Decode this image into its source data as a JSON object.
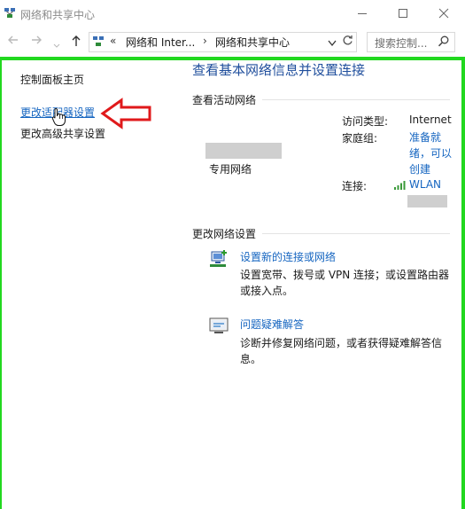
{
  "window": {
    "title": "网络和共享中心"
  },
  "address": {
    "chevrons": "«",
    "segment1": "网络和 Inter...",
    "separator": "›",
    "segment2": "网络和共享中心",
    "search_placeholder": "搜索控制..."
  },
  "sidebar": {
    "items": [
      {
        "label": "控制面板主页"
      },
      {
        "label": "更改适配器设置"
      },
      {
        "label": "更改高级共享设置"
      }
    ]
  },
  "main": {
    "title": "查看基本网络信息并设置连接",
    "active_networks_heading": "查看活动网络",
    "network_type": "专用网络",
    "access_type_label": "访问类型:",
    "access_type_value": "Internet",
    "homegroup_label": "家庭组:",
    "homegroup_value": "准备就绪，可以创建",
    "connection_label": "连接:",
    "connection_value": "WLAN",
    "change_settings_heading": "更改网络设置",
    "tasks": [
      {
        "link": "设置新的连接或网络",
        "desc": "设置宽带、拨号或 VPN 连接；或设置路由器或接入点。"
      },
      {
        "link": "问题疑难解答",
        "desc": "诊断并修复网络问题，或者获得疑难解答信息。"
      }
    ]
  },
  "colors": {
    "accent_link": "#1565c0",
    "frame_green": "#22d81f",
    "annotation_red": "#e0191b",
    "title_blue": "#1f4e9c"
  }
}
